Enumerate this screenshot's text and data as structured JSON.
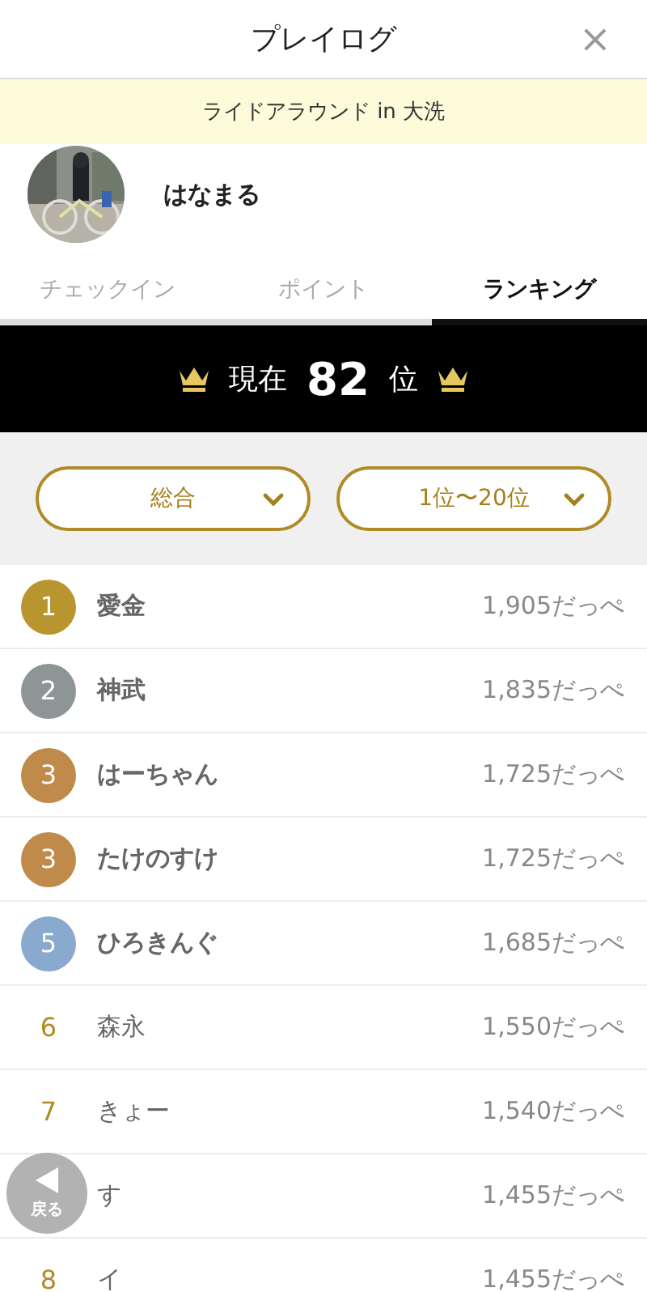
{
  "header": {
    "title": "プレイログ",
    "close": "×"
  },
  "event_banner": "ライドアラウンド in 大洗",
  "profile": {
    "name": "はなまる"
  },
  "tabs": [
    {
      "label": "チェックイン",
      "selected": false
    },
    {
      "label": "ポイント",
      "selected": false
    },
    {
      "label": "ランキング",
      "selected": true
    }
  ],
  "current_rank": {
    "prefix": "現在",
    "rank": "82",
    "suffix": "位"
  },
  "filters": [
    {
      "value": "総合"
    },
    {
      "value": "1位〜20位"
    }
  ],
  "ranking": [
    {
      "kind": "medal",
      "color": "#b8952e",
      "rank": "1",
      "name": "愛金",
      "score": "1,905だっぺ"
    },
    {
      "kind": "medal",
      "color": "#8e9597",
      "rank": "2",
      "name": "神武",
      "score": "1,835だっぺ"
    },
    {
      "kind": "medal",
      "color": "#c08a4a",
      "rank": "3",
      "name": "はーちゃん",
      "score": "1,725だっぺ"
    },
    {
      "kind": "medal",
      "color": "#c08a4a",
      "rank": "3",
      "name": "たけのすけ",
      "score": "1,725だっぺ"
    },
    {
      "kind": "medal",
      "color": "#8aa9cf",
      "rank": "5",
      "name": "ひろきんぐ",
      "score": "1,685だっぺ"
    },
    {
      "kind": "plain",
      "rank": "6",
      "name": "森永",
      "score": "1,550だっぺ"
    },
    {
      "kind": "plain",
      "rank": "7",
      "name": "きょー",
      "score": "1,540だっぺ"
    },
    {
      "kind": "plain",
      "name": "す",
      "score": "1,455だっぺ"
    },
    {
      "kind": "plain",
      "rank": "8",
      "name": "イ",
      "score": "1,455だっぺ"
    }
  ],
  "back_button": {
    "label": "戻る"
  }
}
